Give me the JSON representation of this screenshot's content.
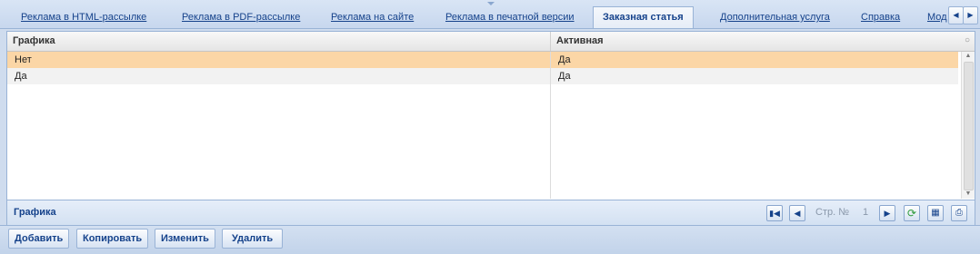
{
  "tabs": [
    {
      "label": "Реклама в HTML-рассылке"
    },
    {
      "label": "Реклама в PDF-рассылке"
    },
    {
      "label": "Реклама на сайте"
    },
    {
      "label": "Реклама в печатной версии"
    },
    {
      "label": "Заказная статья"
    },
    {
      "label": "Дополнительная услуга"
    },
    {
      "label": "Справка"
    },
    {
      "label": "Мод"
    }
  ],
  "active_tab_index": 4,
  "grid": {
    "columns": [
      "Графика",
      "Активная"
    ],
    "rows": [
      {
        "col1": "Нет",
        "col2": "Да",
        "selected": true
      },
      {
        "col1": "Да",
        "col2": "Да",
        "selected": false
      }
    ]
  },
  "footer": {
    "title": "Графика",
    "page_label": "Стр. №",
    "page_number": "1"
  },
  "actions": {
    "add": "Добавить",
    "copy": "Копировать",
    "edit": "Изменить",
    "delete": "Удалить"
  },
  "icons": {
    "first_page": "first-page-icon",
    "prev_page": "prev-page-icon",
    "next_page": "next-page-icon",
    "refresh": "refresh-icon",
    "save": "save-icon",
    "print": "print-icon",
    "scroll_left": "scroll-left-icon",
    "scroll_right": "scroll-right-icon"
  },
  "colors": {
    "selected_row": "#fbd6a6",
    "accent": "#15428b",
    "refresh": "#2e9b3c"
  }
}
